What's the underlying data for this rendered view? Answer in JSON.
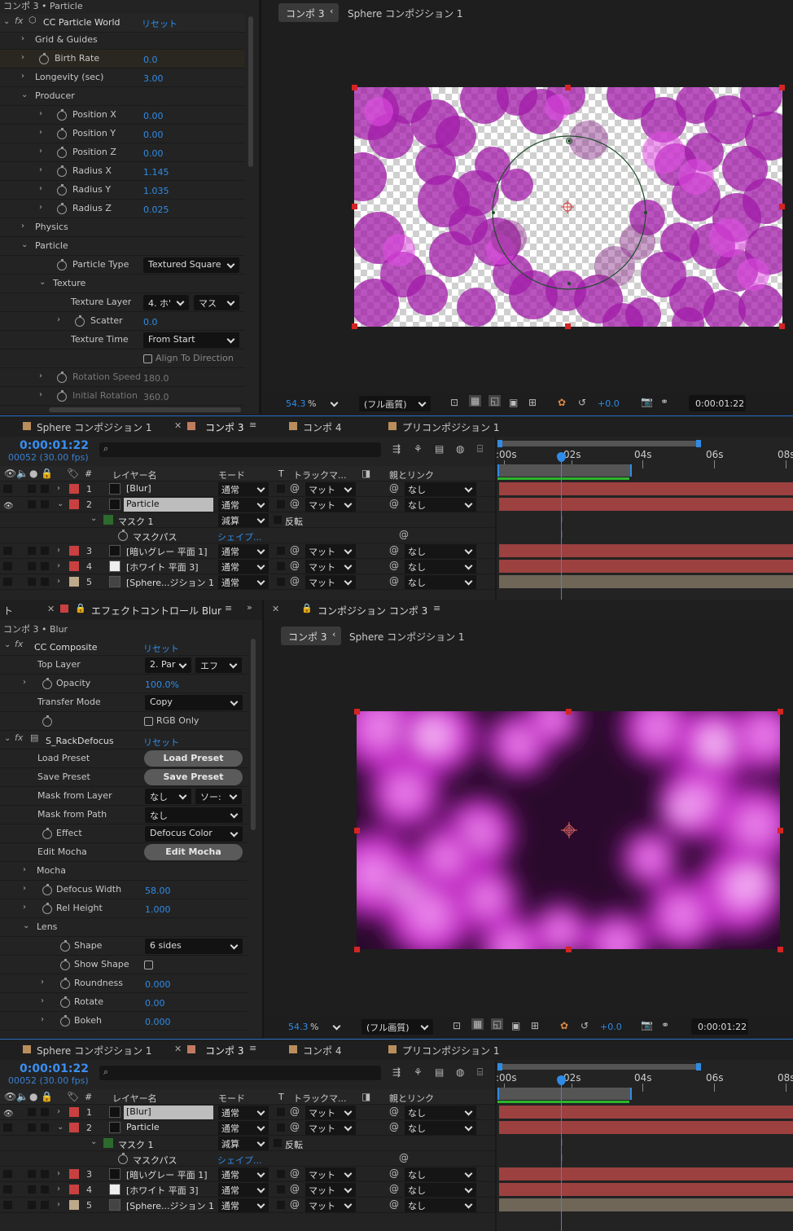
{
  "top_effects": {
    "breadcrumb": "コンポ 3 • Particle",
    "effect_name": "CC Particle World",
    "reset": "リセット",
    "rows": [
      {
        "label": "Grid & Guides",
        "value": ""
      },
      {
        "label": "Birth Rate",
        "value": "0.0"
      },
      {
        "label": "Longevity (sec)",
        "value": "3.00"
      },
      {
        "label": "Producer",
        "value": ""
      },
      {
        "label": "Position X",
        "value": "0.00"
      },
      {
        "label": "Position Y",
        "value": "0.00"
      },
      {
        "label": "Position Z",
        "value": "0.00"
      },
      {
        "label": "Radius X",
        "value": "1.145"
      },
      {
        "label": "Radius Y",
        "value": "1.035"
      },
      {
        "label": "Radius Z",
        "value": "0.025"
      },
      {
        "label": "Physics",
        "value": ""
      },
      {
        "label": "Particle",
        "value": ""
      },
      {
        "label": "Particle Type",
        "value": "Textured Square"
      },
      {
        "label": "Texture",
        "value": ""
      },
      {
        "label": "Texture Layer",
        "value": "4. ホ'",
        "value2": "マス"
      },
      {
        "label": "Scatter",
        "value": "0.0"
      },
      {
        "label": "Texture Time",
        "value": "From Start"
      },
      {
        "label": "Align To Direction",
        "value": ""
      },
      {
        "label": "Rotation Speed",
        "value": "180.0"
      },
      {
        "label": "Initial Rotation",
        "value": "360.0"
      }
    ]
  },
  "top_viewer": {
    "tab_comp": "コンポ 3",
    "breadcrumb_comp": "Sphere コンポジション 1",
    "zoom": "54.3",
    "zoom_unit": "%",
    "quality": "(フル画質)",
    "exposure": "+0.0",
    "timecode": "0:00:01:22"
  },
  "timeline1": {
    "tabs": [
      "Sphere コンポジション 1",
      "コンポ 3",
      "コンポ 4",
      "プリコンポジション 1"
    ],
    "timecode": "0:00:01:22",
    "frames": "00052 (30.00 fps)",
    "headers": {
      "layer_name": "レイヤー名",
      "mode": "モード",
      "t": "T",
      "track_matte": "トラックマ...",
      "parent": "親とリンク"
    },
    "ruler": [
      ":00s",
      "02s",
      "04s",
      "06s",
      "08s"
    ],
    "layers": [
      {
        "num": "1",
        "name": "[Blur]",
        "mode": "通常",
        "matte": "マット",
        "parent": "なし"
      },
      {
        "num": "2",
        "name": "Particle",
        "mode": "通常",
        "matte": "マット",
        "parent": "なし"
      },
      {
        "num": "",
        "name": "マスク 1",
        "mode": "減算",
        "matte": "反転",
        "parent": ""
      },
      {
        "num": "",
        "name": "マスクパス",
        "mode": "シェイプ...",
        "matte": "",
        "parent": ""
      },
      {
        "num": "3",
        "name": "[暗いグレー 平面 1]",
        "mode": "通常",
        "matte": "マット",
        "parent": "なし"
      },
      {
        "num": "4",
        "name": "[ホワイト 平面 3]",
        "mode": "通常",
        "matte": "マット",
        "parent": "なし"
      },
      {
        "num": "5",
        "name": "[Sphere...ジション 1]",
        "mode": "通常",
        "matte": "マット",
        "parent": "なし"
      }
    ]
  },
  "bottom_effects": {
    "panel_title": "エフェクトコントロール Blur",
    "breadcrumb": "コンポ 3 • Blur",
    "edge_label": "ト",
    "fx1": "CC Composite",
    "fx2": "S_RackDefocus",
    "reset": "リセット",
    "rows": [
      {
        "label": "Top Layer",
        "value": "2. Par",
        "value2": "エフ"
      },
      {
        "label": "Opacity",
        "value": "100.0%"
      },
      {
        "label": "Transfer Mode",
        "value": "Copy"
      },
      {
        "label": "RGB Only",
        "value": ""
      },
      {
        "label": "Load Preset",
        "value": "Load Preset"
      },
      {
        "label": "Save Preset",
        "value": "Save Preset"
      },
      {
        "label": "Mask from Layer",
        "value": "なし",
        "value2": "ソー:"
      },
      {
        "label": "Mask from Path",
        "value": "なし"
      },
      {
        "label": "Effect",
        "value": "Defocus Color"
      },
      {
        "label": "Edit Mocha",
        "value": "Edit Mocha"
      },
      {
        "label": "Mocha",
        "value": ""
      },
      {
        "label": "Defocus Width",
        "value": "58.00"
      },
      {
        "label": "Rel Height",
        "value": "1.000"
      },
      {
        "label": "Lens",
        "value": ""
      },
      {
        "label": "Shape",
        "value": "6 sides"
      },
      {
        "label": "Show Shape",
        "value": ""
      },
      {
        "label": "Roundness",
        "value": "0.000"
      },
      {
        "label": "Rotate",
        "value": "0.00"
      },
      {
        "label": "Bokeh",
        "value": "0.000"
      }
    ]
  },
  "bottom_viewer": {
    "panel_title": "コンポジション コンポ 3",
    "tab_comp": "コンポ 3",
    "breadcrumb_comp": "Sphere コンポジション 1",
    "zoom": "54.3",
    "zoom_unit": "%",
    "quality": "(フル画質)",
    "exposure": "+0.0",
    "timecode": "0:00:01:22"
  },
  "timeline2": {
    "tabs": [
      "Sphere コンポジション 1",
      "コンポ 3",
      "コンポ 4",
      "プリコンポジション 1"
    ],
    "timecode": "0:00:01:22",
    "frames": "00052 (30.00 fps)",
    "headers": {
      "layer_name": "レイヤー名",
      "mode": "モード",
      "t": "T",
      "track_matte": "トラックマ...",
      "parent": "親とリンク"
    },
    "ruler": [
      ":00s",
      "02s",
      "04s",
      "06s",
      "08s"
    ],
    "layers": [
      {
        "num": "1",
        "name": "[Blur]",
        "mode": "通常",
        "matte": "マット",
        "parent": "なし"
      },
      {
        "num": "2",
        "name": "Particle",
        "mode": "通常",
        "matte": "マット",
        "parent": "なし"
      },
      {
        "num": "",
        "name": "マスク 1",
        "mode": "減算",
        "matte": "反転",
        "parent": ""
      },
      {
        "num": "",
        "name": "マスクパス",
        "mode": "シェイプ...",
        "matte": "",
        "parent": ""
      },
      {
        "num": "3",
        "name": "[暗いグレー 平面 1]",
        "mode": "通常",
        "matte": "マット",
        "parent": "なし"
      },
      {
        "num": "4",
        "name": "[ホワイト 平面 3]",
        "mode": "通常",
        "matte": "マット",
        "parent": "なし"
      },
      {
        "num": "5",
        "name": "[Sphere...ジション 1]",
        "mode": "通常",
        "matte": "マット",
        "parent": "なし"
      }
    ]
  }
}
